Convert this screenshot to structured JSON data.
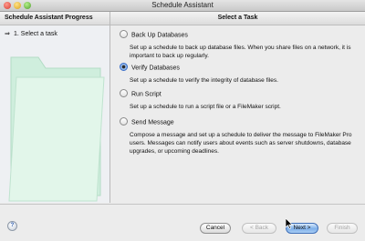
{
  "window": {
    "title": "Schedule Assistant"
  },
  "sidebar": {
    "heading": "Schedule Assistant Progress",
    "steps": [
      {
        "label": "1. Select a task",
        "marker": "⇒"
      }
    ]
  },
  "main": {
    "heading": "Select a Task",
    "options": [
      {
        "label": "Back Up Databases",
        "selected": false,
        "description": "Set up a schedule to back up database files. When you share files on a network, it is important to back up regularly."
      },
      {
        "label": "Verify Databases",
        "selected": true,
        "description": "Set up a schedule to verify the integrity of database files."
      },
      {
        "label": "Run Script",
        "selected": false,
        "description": "Set up a schedule to run a script file or a FileMaker script."
      },
      {
        "label": "Send Message",
        "selected": false,
        "description": "Compose a message and set up a schedule to deliver the message to FileMaker Pro users. Messages can notify users about events such as server shutdowns, database upgrades, or upcoming deadlines."
      }
    ]
  },
  "footer": {
    "help_glyph": "?",
    "cancel": "Cancel",
    "back": "< Back",
    "next": "Next >",
    "finish": "Finish"
  },
  "icons": {
    "help": "help-icon",
    "step_marker": "arrow-right-icon",
    "watermark": "folder-graphic"
  },
  "colors": {
    "selected_radio": "#5b93de",
    "default_button": "#7eb0ea",
    "folder_graphic": "#cfeedd"
  }
}
